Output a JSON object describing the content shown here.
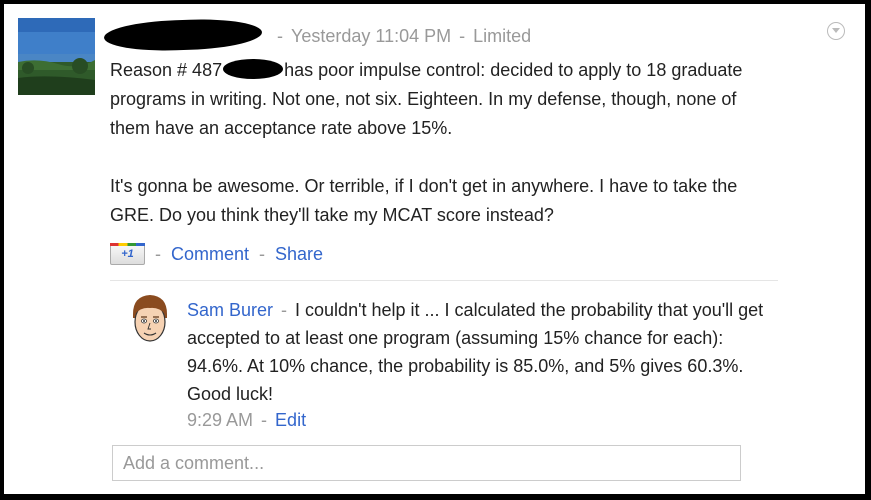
{
  "post": {
    "timestamp": "Yesterday 11:04 PM",
    "visibility": "Limited",
    "text_prefix": "Reason # 487",
    "text_rest": "has poor impulse control: decided to apply to 18 graduate programs in writing. Not one, not six. Eighteen. In my defense, though, none of them have an acceptance rate above 15%.",
    "paragraph2": "It's gonna be awesome. Or terrible, if I don't get in anywhere. I have to take the GRE. Do you think they'll take my MCAT score instead?"
  },
  "actions": {
    "plusone_label": "+1",
    "comment_label": "Comment",
    "share_label": "Share",
    "separator": "-"
  },
  "comment": {
    "author": "Sam Burer",
    "text": "I couldn't help it ... I calculated the probability that you'll get accepted to at least one program (assuming 15% chance for each): 94.6%. At 10% chance, the probability is 85.0%, and 5% gives 60.3%. Good luck!",
    "time": "9:29 AM",
    "edit_label": "Edit"
  },
  "add_comment": {
    "placeholder": "Add a comment..."
  },
  "colors": {
    "link": "#3366cc",
    "meta": "#999999",
    "text": "#222222"
  }
}
